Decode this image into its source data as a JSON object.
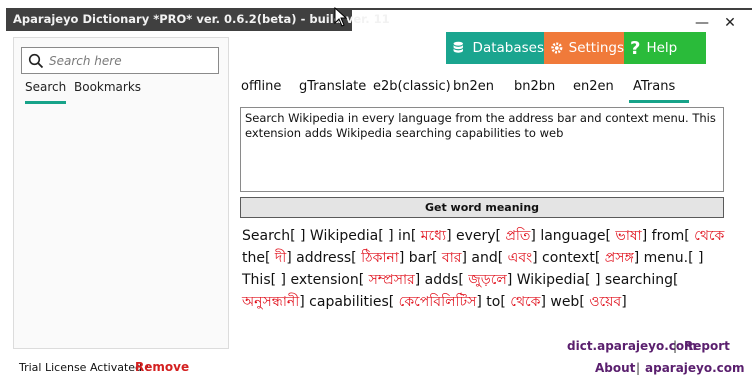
{
  "window": {
    "title": "Aparajeyo Dictionary *PRO* ver. 0.6.2(beta) - build ver. 11",
    "minimize": "—",
    "close": "✕"
  },
  "left": {
    "search_placeholder": "Search here",
    "tabs": [
      "Search",
      "Bookmarks"
    ]
  },
  "toolbar": {
    "databases": "Databases",
    "settings": "Settings",
    "help": "Help"
  },
  "translator_tabs": [
    "offline",
    "gTranslate",
    "e2b(classic)",
    "bn2en",
    "bn2bn",
    "en2en",
    "ATrans"
  ],
  "input_text": "Search Wikipedia in every language from the address bar and context menu. This extension adds Wikipedia searching capabilities to web",
  "get_meaning_label": "Get word meaning",
  "result": [
    {
      "en": "Search[",
      "bn": " ",
      "end": "]"
    },
    {
      "en": " Wikipedia[",
      "bn": " ",
      "end": "]"
    },
    {
      "en": " in[",
      "bn": " মধ্যে",
      "end": "]"
    },
    {
      "en": " every[",
      "bn": " প্রতি",
      "end": "]"
    },
    {
      "en": " language[",
      "bn": " ভাষা",
      "end": "]"
    },
    {
      "en": " from[",
      "bn": " থেকে",
      "end": ""
    },
    {
      "en": " the[",
      "bn": " দী",
      "end": "]"
    },
    {
      "en": " address[",
      "bn": " ঠিকানা",
      "end": "]"
    },
    {
      "en": " bar[",
      "bn": " বার",
      "end": "]"
    },
    {
      "en": " and[",
      "bn": " এবং",
      "end": "]"
    },
    {
      "en": " context[",
      "bn": " প্রসঙ্গ",
      "end": "]"
    },
    {
      "en": " menu.[",
      "bn": " ",
      "end": "]"
    },
    {
      "en": " This[",
      "bn": " ",
      "end": "]"
    },
    {
      "en": " extension[",
      "bn": " সম্প্রসার",
      "end": "]"
    },
    {
      "en": " adds[",
      "bn": " জুড়লে",
      "end": "]"
    },
    {
      "en": " Wikipedia[",
      "bn": " ",
      "end": "]"
    },
    {
      "en": " searching[",
      "bn": "",
      "end": ""
    },
    {
      "en": " ",
      "bn": "অনুসন্ধানী",
      "end": "]"
    },
    {
      "en": " capabilities[",
      "bn": " কেপেবিলিটিস",
      "end": "]"
    },
    {
      "en": " to[",
      "bn": " থেকে",
      "end": "]"
    },
    {
      "en": " web[",
      "bn": " ওয়েব",
      "end": "]"
    }
  ],
  "footer": {
    "site": "dict.aparajeyo.com",
    "report": "Report",
    "about": "About",
    "site2": "aparajeyo.com",
    "separator": "|",
    "license_text": "Trial License Activated :",
    "remove": "Remove"
  }
}
